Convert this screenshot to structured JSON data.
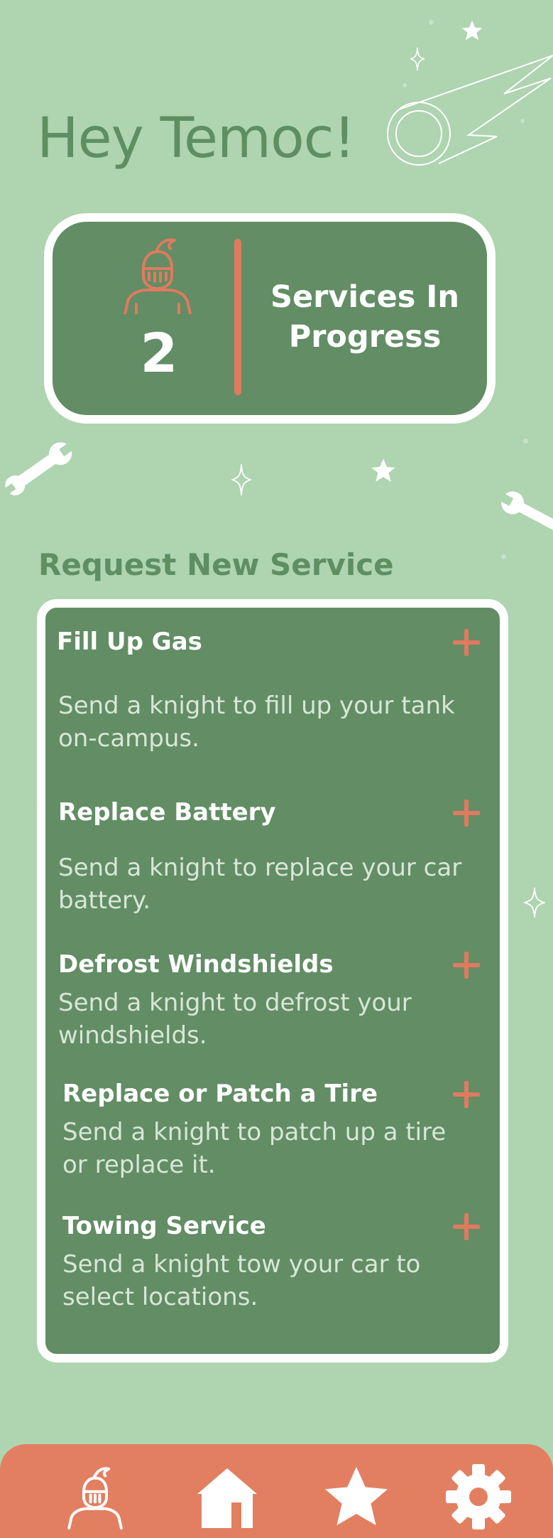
{
  "header": {
    "greeting": "Hey Temoc!"
  },
  "summary": {
    "count": "2",
    "label": "Services In Progress"
  },
  "request_section": {
    "title": "Request New Service"
  },
  "services": [
    {
      "title": "Fill Up Gas",
      "description": "Send a knight to fill up your tank\n on-campus."
    },
    {
      "title": "Replace Battery",
      "description": "Send a knight to replace your car\nbattery."
    },
    {
      "title": "Defrost Windshields",
      "description": "Send a knight to defrost your\nwindshields."
    },
    {
      "title": "Replace or Patch a Tire",
      "description": "Send a knight to patch up a tire\n or replace it."
    },
    {
      "title": "Towing Service",
      "description": "Send a knight tow your car to\nselect locations."
    }
  ],
  "nav": {
    "items": [
      {
        "icon": "knight-icon"
      },
      {
        "icon": "home-icon"
      },
      {
        "icon": "star-icon"
      },
      {
        "icon": "gear-icon"
      }
    ]
  },
  "colors": {
    "background": "#aed4b0",
    "card": "#628d65",
    "accent": "#e07a5f",
    "heading": "#5e8f62"
  }
}
